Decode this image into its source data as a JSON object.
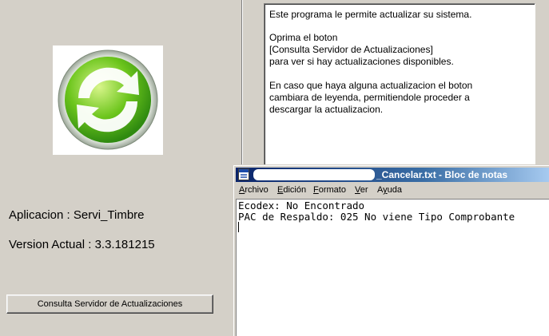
{
  "app": {
    "application_label": "Aplicacion : Servi_Timbre",
    "version_label": "Version Actual : 3.3.181215",
    "check_button_label": "Consulta Servidor de Actualizaciones",
    "logo_icon": "refresh-arrows-icon",
    "logo_colors": {
      "green": "#4cbb17",
      "light_green": "#a8e04a",
      "white": "#ffffff"
    }
  },
  "info": {
    "lines": [
      "Este programa le permite actualizar su sistema.",
      "Oprima el boton",
      "[Consulta Servidor de Actualizaciones]",
      "para ver si hay actualizaciones disponibles.",
      "En caso que haya alguna actualizacion el boton",
      "cambiara de leyenda, permitiendole proceder a",
      "descargar la actualizacion."
    ]
  },
  "notepad": {
    "title": "_Cancelar.txt - Bloc de notas",
    "menu": [
      "Archivo",
      "Edición",
      "Formato",
      "Ver",
      "Ayuda"
    ],
    "content_lines": [
      "Ecodex: No Encontrado",
      "PAC de Respaldo: 025 No viene Tipo Comprobante"
    ],
    "titlebar_colors": [
      "#0a246a",
      "#a6caf0"
    ]
  }
}
